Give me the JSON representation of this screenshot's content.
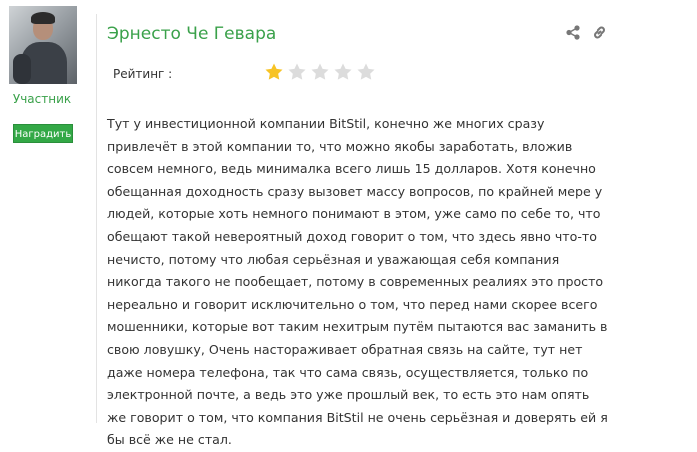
{
  "author": {
    "name": "Эрнесто Че Гевара",
    "role": "Участник",
    "award_button": "Наградить"
  },
  "icons": {
    "share": "share-icon",
    "link": "link-icon"
  },
  "rating": {
    "label": "Рейтинг :",
    "value": 1,
    "max": 5,
    "filled_color": "#f7c325",
    "empty_color": "#dcdcdc"
  },
  "review": {
    "text": "Тут у инвестиционной компании BitStil, конечно же многих сразу привлечёт в этой компании то, что можно якобы заработать, вложив совсем немного, ведь минималка всего лишь 15 долларов. Хотя конечно обещанная доходность сразу вызовет массу вопросов, по крайней мере у людей, которые хоть немного понимают в этом, уже само по себе то, что обещают такой невероятный доход говорит о том, что здесь явно что-то нечисто, потому что любая серьёзная и уважающая себя компания никогда такого не пообещает, потому в современных реалиях это просто нереально и говорит исключительно о том, что перед нами скорее всего мошенники, которые вот таким нехитрым путём пытаются вас заманить в свою ловушку, Очень настораживает обратная связь на сайте, тут нет даже номера телефона, так что сама связь, осуществляется, только по электронной почте, а ведь это уже прошлый век, то есть это нам опять же говорит о том, что компания BitStil не очень серьёзная и доверять ей я бы всё же не стал."
  },
  "colors": {
    "accent": "#3aa14a",
    "button_bg": "#33a846",
    "text": "#333333",
    "icon": "#777777"
  }
}
